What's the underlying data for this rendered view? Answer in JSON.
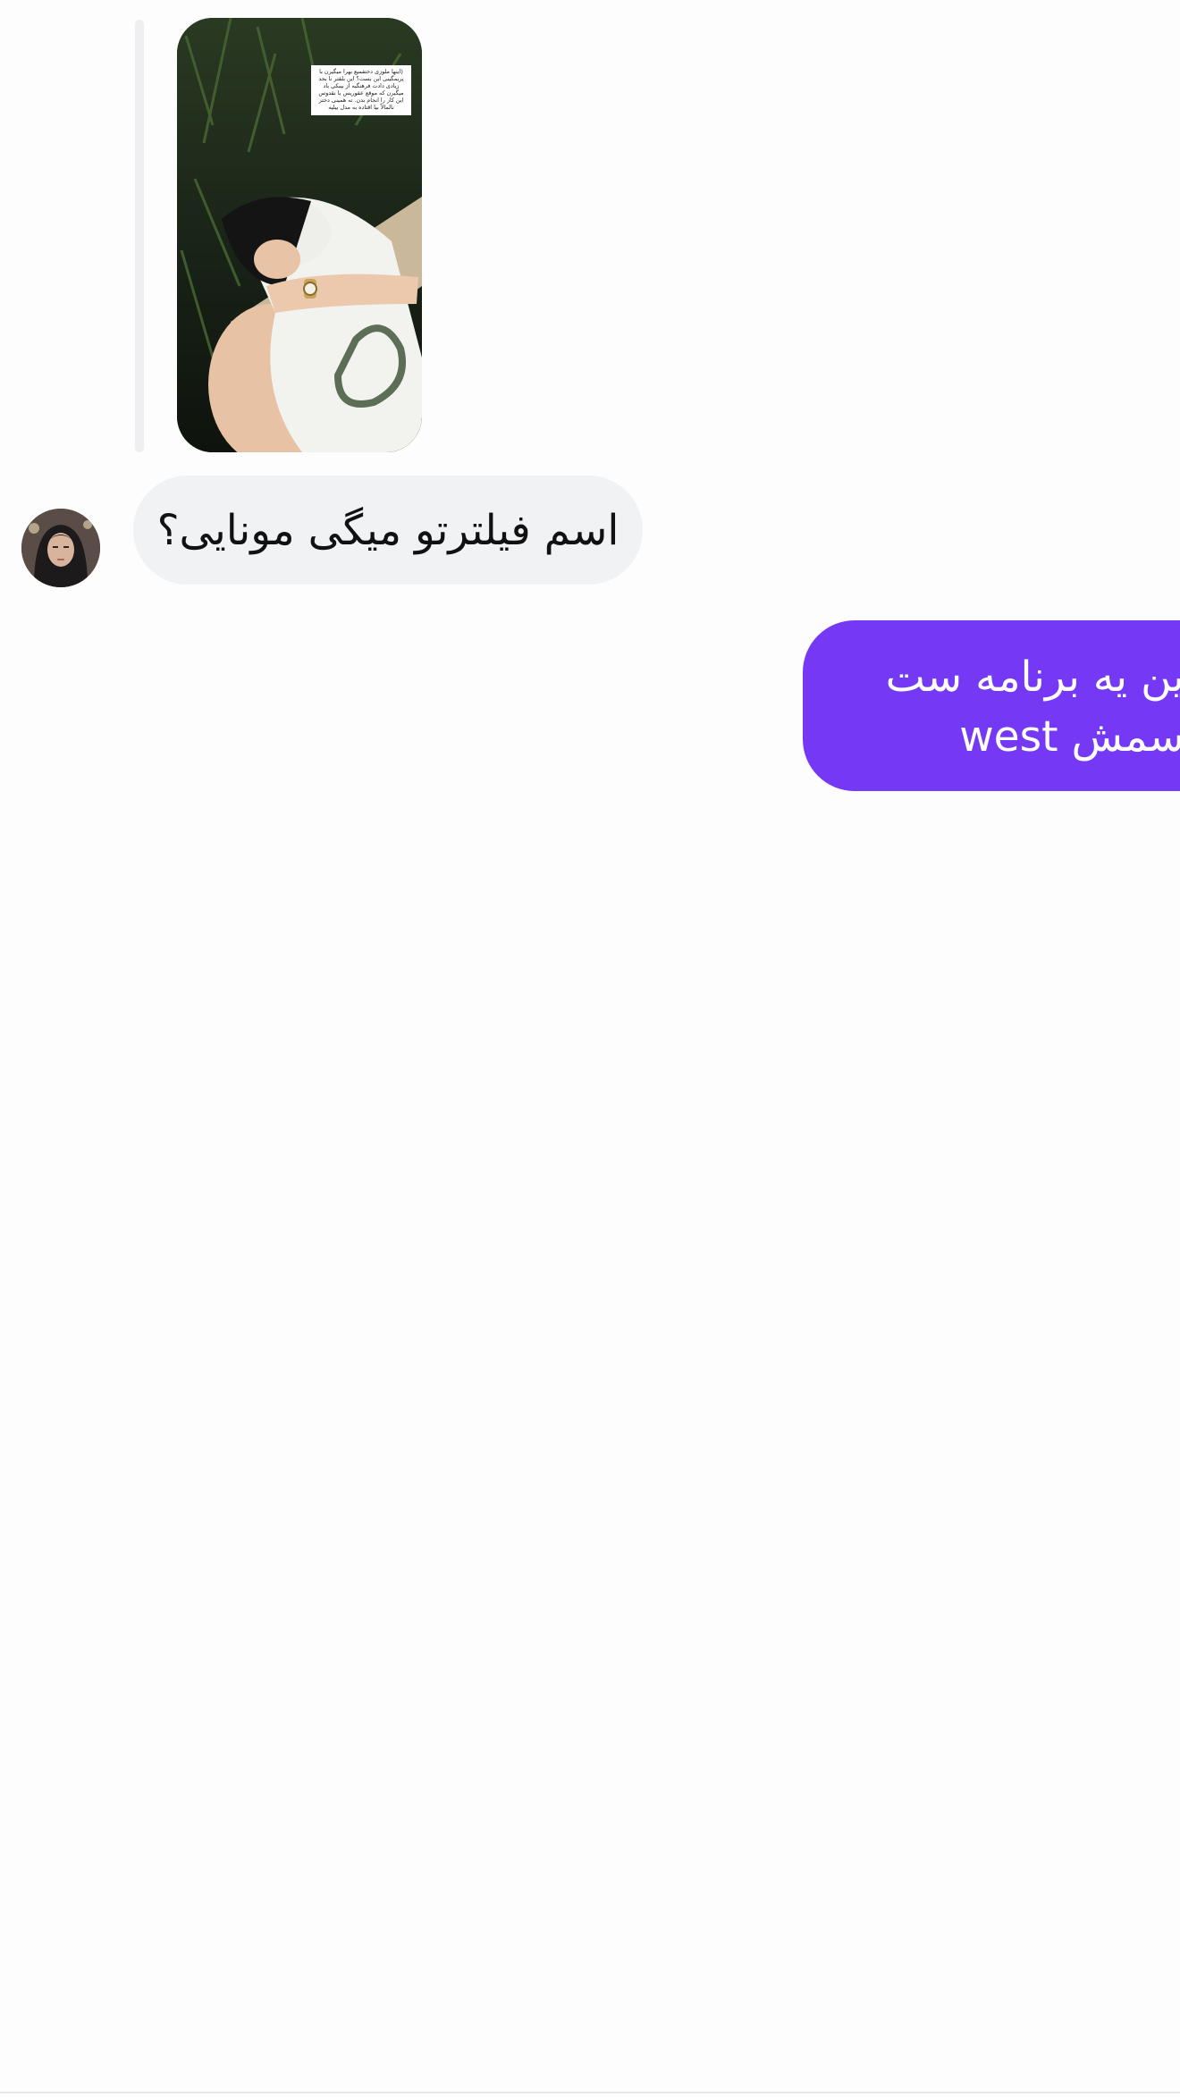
{
  "story_reply": {
    "caption_text": "(اینها ملوزی دختفمیع بهرا میگیرن با پریمگینی این بست؟ این بلقتر نا بحد زیادی دادت فرهنگیه از بیبکی باد میگیرن که موقع عقوریس با نقدوس این کار را انجام بدن. ته همینی دختر نالمالاً بیا اقتاده به مدل بیلیه"
  },
  "incoming": {
    "text": "اسم فیلترتو میگی مونایی؟"
  },
  "outgoing": {
    "line1": "این یه برنامه ست",
    "line2_fa": "اسمش",
    "line2_en": "west"
  },
  "colors": {
    "outgoing_bubble": "#7539f6",
    "incoming_bubble": "#f1f2f4",
    "background": "#fdfdfd"
  }
}
